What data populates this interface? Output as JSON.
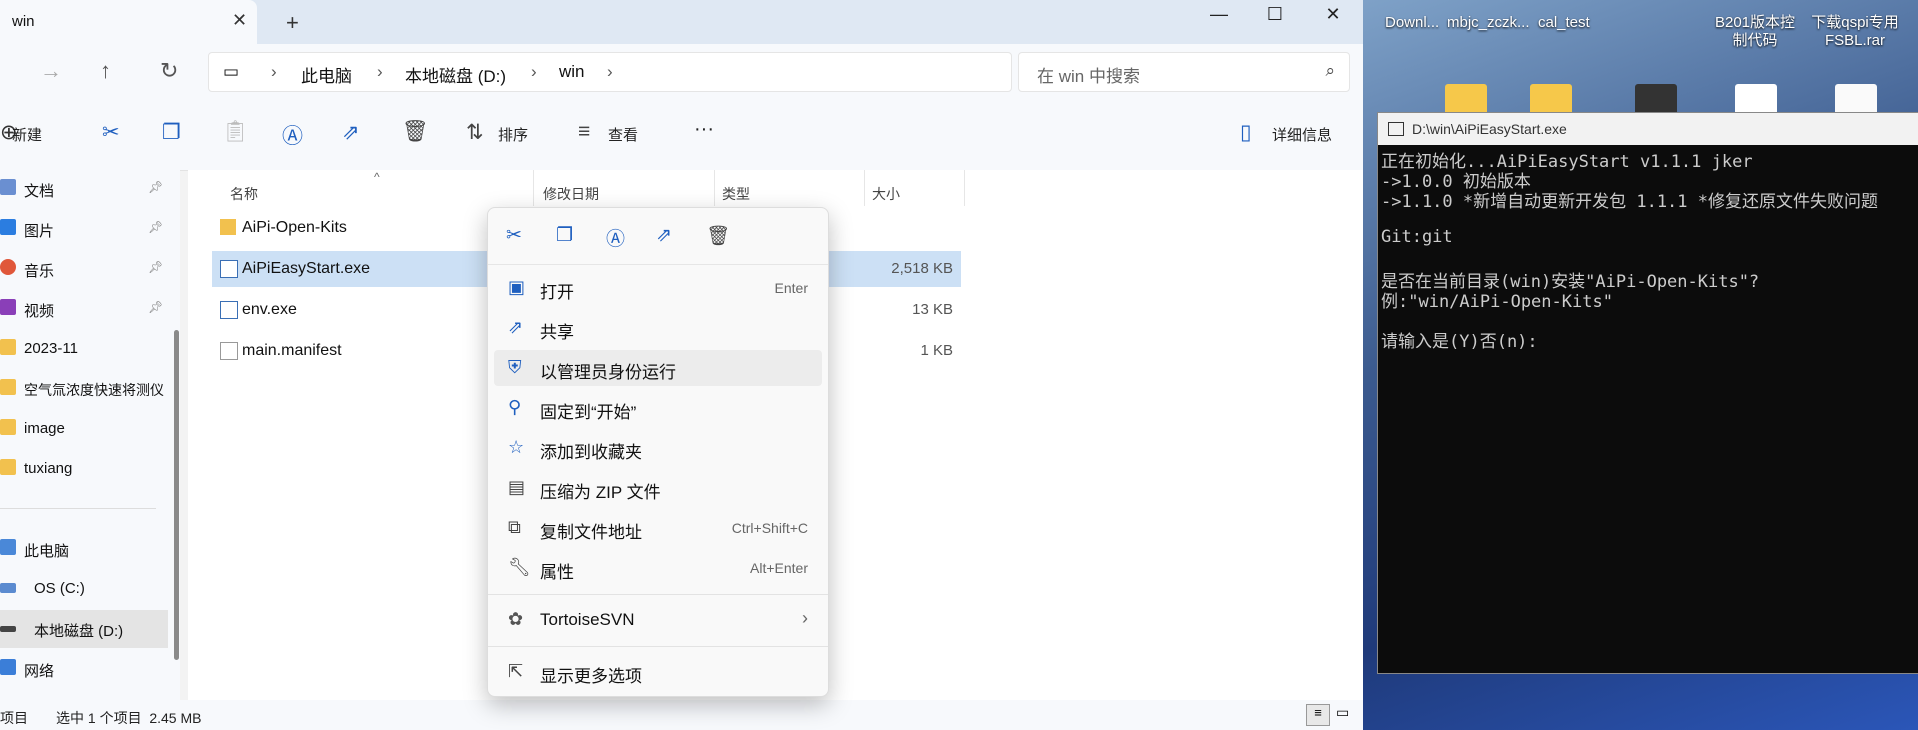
{
  "tab": {
    "title": "win"
  },
  "address": {
    "crumbs": [
      "此电脑",
      "本地磁盘 (D:)",
      "win"
    ]
  },
  "search": {
    "placeholder": "在 win 中搜索"
  },
  "toolbar": {
    "new_label": "新建",
    "sort_label": "排序",
    "view_label": "查看",
    "more_label": "···",
    "details_label": "详细信息"
  },
  "sidebar": {
    "items": [
      {
        "label": "文档",
        "pinned": true
      },
      {
        "label": "图片",
        "pinned": true
      },
      {
        "label": "音乐",
        "pinned": true
      },
      {
        "label": "视频",
        "pinned": true
      },
      {
        "label": "2023-11"
      },
      {
        "label": "空气氚浓度快速将测仪"
      },
      {
        "label": "image"
      },
      {
        "label": "tuxiang"
      },
      {
        "label": "此电脑"
      },
      {
        "label": "OS (C:)"
      },
      {
        "label": "本地磁盘 (D:)",
        "selected": true
      },
      {
        "label": "网络"
      }
    ]
  },
  "columns": {
    "name": "名称",
    "modified": "修改日期",
    "type": "类型",
    "size": "大小"
  },
  "files": [
    {
      "name": "AiPi-Open-Kits",
      "size": "",
      "icon": "folder-icon"
    },
    {
      "name": "AiPiEasyStart.exe",
      "size": "2,518 KB",
      "icon": "exe-icon",
      "selected": true
    },
    {
      "name": "env.exe",
      "size": "13 KB",
      "icon": "exe-icon"
    },
    {
      "name": "main.manifest",
      "size": "1 KB",
      "icon": "file-icon"
    }
  ],
  "status": {
    "count": "项目",
    "selected": "选中 1 个项目  2.45 MB"
  },
  "context_menu": {
    "items": [
      {
        "label": "打开",
        "shortcut": "Enter",
        "icon": "open-icon"
      },
      {
        "label": "共享",
        "shortcut": "",
        "icon": "share-icon"
      },
      {
        "label": "以管理员身份运行",
        "shortcut": "",
        "icon": "shield-icon"
      },
      {
        "label": "固定到“开始”",
        "shortcut": "",
        "icon": "pin-icon"
      },
      {
        "label": "添加到收藏夹",
        "shortcut": "",
        "icon": "star-icon"
      },
      {
        "label": "压缩为 ZIP 文件",
        "shortcut": "",
        "icon": "zip-icon"
      },
      {
        "label": "复制文件地址",
        "shortcut": "Ctrl+Shift+C",
        "icon": "path-icon"
      },
      {
        "label": "属性",
        "shortcut": "Alt+Enter",
        "icon": "wrench-icon"
      }
    ],
    "tortoise": "TortoiseSVN",
    "more": "显示更多选项"
  },
  "desktop": {
    "icons": [
      "Downl...",
      "mbjc_zczk...",
      "cal_test",
      "B201版本控\n制代码",
      "下载qspi专用\nFSBL.rar"
    ]
  },
  "console": {
    "title": "D:\\win\\AiPiEasyStart.exe",
    "lines": [
      "正在初始化...AiPiEasyStart v1.1.1 jker",
      "->1.0.0 初始版本",
      "->1.1.0 *新增自动更新开发包 1.1.1 *修复还原文件失败问题",
      "",
      "Git:git",
      "",
      "是否在当前目录(win)安装\"AiPi-Open-Kits\"?",
      "例:\"win/AiPi-Open-Kits\"",
      "",
      "请输入是(Y)否(n):"
    ]
  },
  "colors": {
    "accent": "#1f5fbf",
    "selection": "#cce0f5",
    "console_bg": "#0c0c0c"
  }
}
